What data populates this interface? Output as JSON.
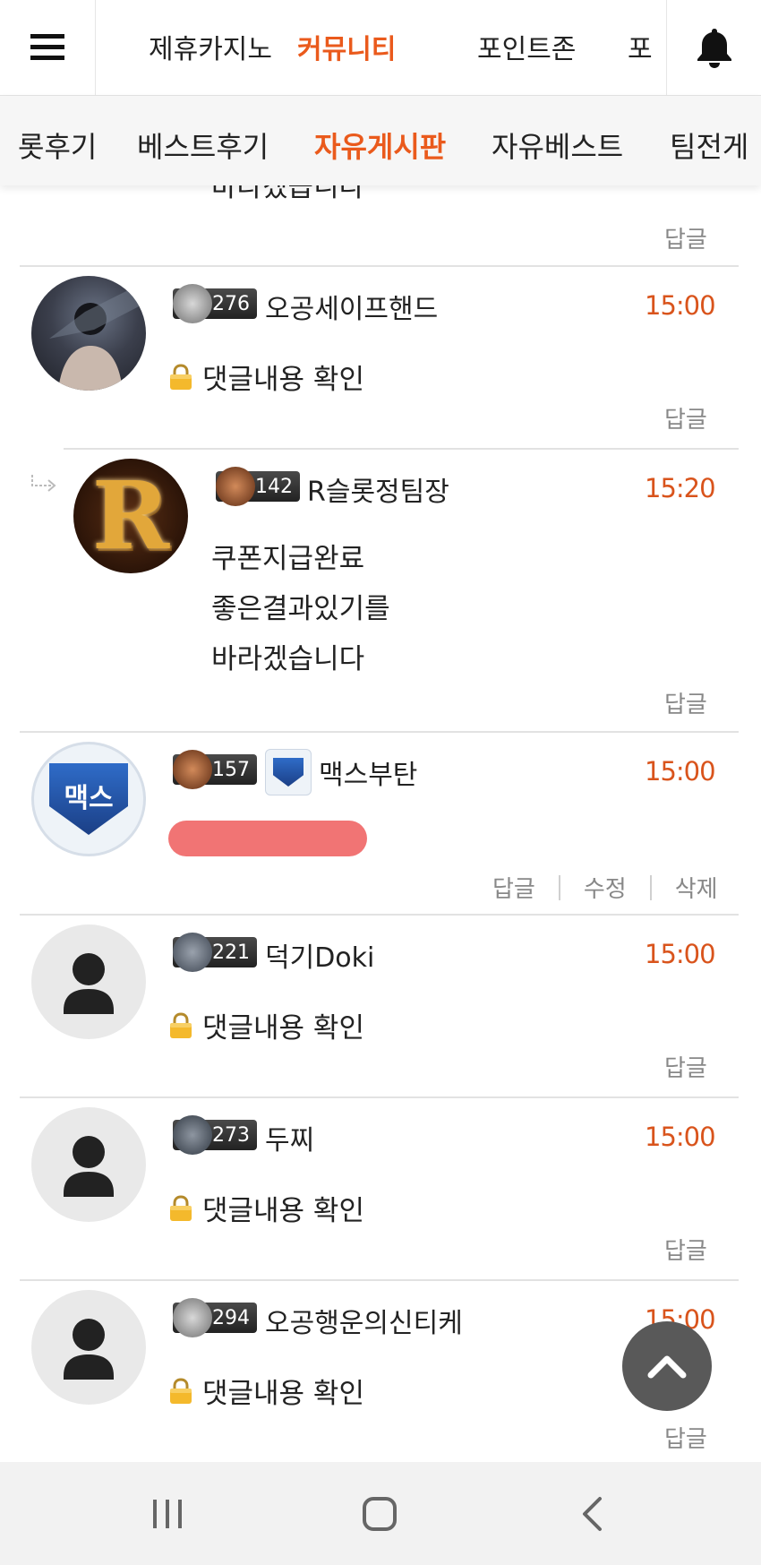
{
  "topnav": {
    "items": [
      "제휴카지노",
      "커뮤니티",
      "포인트존",
      "포"
    ],
    "active_index": 1
  },
  "subnav": {
    "items": [
      "롯후기",
      "베스트후기",
      "자유게시판",
      "자유베스트",
      "팀전게"
    ],
    "active_index": 2
  },
  "partial_comment": {
    "text_tail": "바라겠습니다",
    "reply_label": "답글"
  },
  "comments": [
    {
      "level": "276",
      "nickname": "오공세이프핸드",
      "time": "15:00",
      "lock_text": "댓글내용 확인",
      "actions": [
        "답글"
      ]
    },
    {
      "level": "142",
      "nickname": "R슬롯정팀장",
      "time": "15:20",
      "lines": [
        "쿠폰지급완료",
        "좋은결과있기를",
        "바라겠습니다"
      ],
      "actions": [
        "답글"
      ],
      "is_reply": true,
      "avatar_letter": "R"
    },
    {
      "level": "157",
      "nickname": "맥스부탄",
      "time": "15:00",
      "avatar_text": "맥스",
      "actions": [
        "답글",
        "수정",
        "삭제"
      ],
      "redacted": true
    },
    {
      "level": "221",
      "nickname": "덕기Doki",
      "time": "15:00",
      "lock_text": "댓글내용 확인",
      "actions": [
        "답글"
      ]
    },
    {
      "level": "273",
      "nickname": "두찌",
      "time": "15:00",
      "lock_text": "댓글내용 확인",
      "actions": [
        "답글"
      ]
    },
    {
      "level": "294",
      "nickname": "오공행운의신티케",
      "time": "15:00",
      "lock_text": "댓글내용 확인",
      "actions": [
        "답글"
      ]
    }
  ],
  "colors": {
    "accent": "#ea5a1c",
    "time": "#d9541c",
    "divider": "#e2e2e2"
  }
}
